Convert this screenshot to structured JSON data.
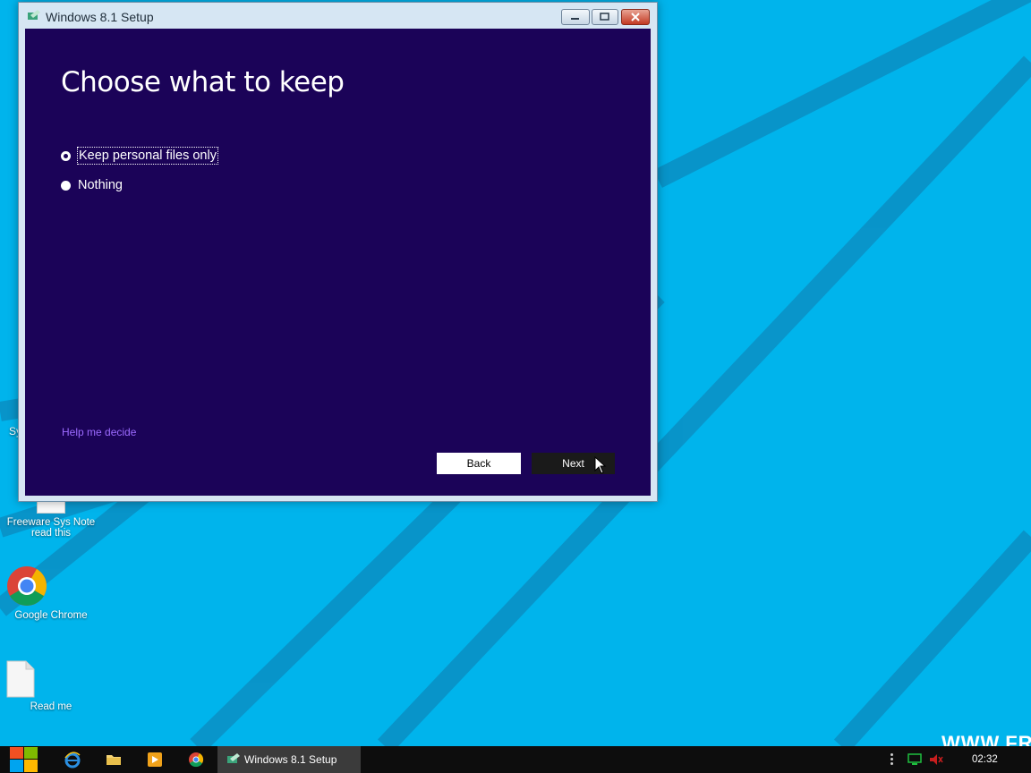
{
  "window": {
    "title": "Windows 8.1 Setup",
    "heading": "Choose what to keep",
    "options": [
      {
        "label": "Keep personal files only",
        "selected": true
      },
      {
        "label": "Nothing",
        "selected": false
      }
    ],
    "help_link": "Help me decide",
    "back_label": "Back",
    "next_label": "Next"
  },
  "desktop": {
    "partial_icon_label": "Sy",
    "icons": [
      {
        "label_line1": "Freeware Sys Note",
        "label_line2": "read this"
      },
      {
        "label_line1": "Google Chrome"
      },
      {
        "label_line1": "Read me"
      }
    ],
    "watermark": "WWW.FR"
  },
  "taskbar": {
    "active_task": "Windows 8.1 Setup",
    "clock": "02:32",
    "pinned": [
      "internet-explorer-icon",
      "file-explorer-icon",
      "media-player-icon",
      "chrome-icon"
    ]
  },
  "colors": {
    "desktop": "#00b4ec",
    "setup_background": "#1b0358",
    "help_link": "#9c6bff",
    "taskbar": "#0d0d0d"
  }
}
